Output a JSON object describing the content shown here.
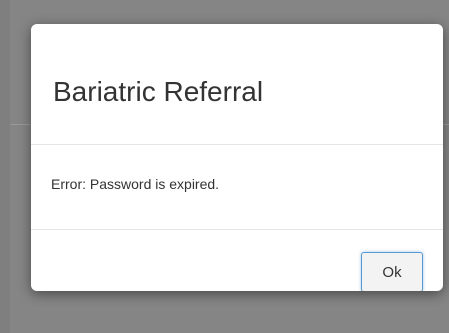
{
  "dialog": {
    "title": "Bariatric Referral",
    "message": "Error: Password is expired.",
    "ok_label": "Ok"
  }
}
